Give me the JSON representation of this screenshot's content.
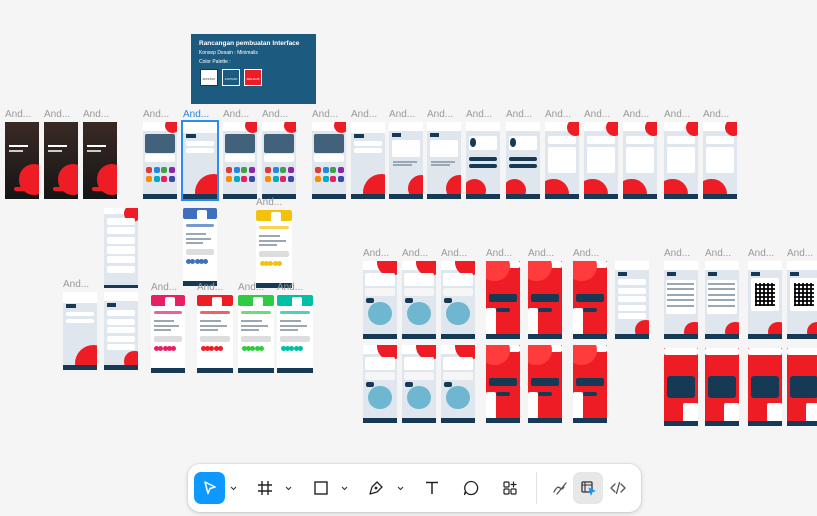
{
  "canvas": {
    "frame_label": "And...",
    "selected_frame_label": "And..."
  },
  "spec_card": {
    "title": "Rancangan pembuatan Interface",
    "concept": "Konsep Desain : Minimalis",
    "palette_label": "Color Palette :",
    "swatches": [
      {
        "label": "#FFFFFF",
        "color": "#ffffff"
      },
      {
        "label": "#1D5A80",
        "color": "#1d5a80"
      },
      {
        "label": "#EE1C25",
        "color": "#ee1c25"
      }
    ]
  },
  "colors": {
    "accent": "#0d99ff",
    "brand_navy": "#163a55",
    "brand_red": "#ee1c25",
    "canvas_bg": "#f5f5f5"
  },
  "toolbar": {
    "tools": [
      {
        "name": "move-tool",
        "icon": "cursor-icon",
        "active": true
      },
      {
        "name": "frame-tool",
        "icon": "hash-frame-icon"
      },
      {
        "name": "shape-tool",
        "icon": "rectangle-icon"
      },
      {
        "name": "pen-tool",
        "icon": "pen-icon"
      },
      {
        "name": "text-tool",
        "icon": "text-icon"
      },
      {
        "name": "comment-tool",
        "icon": "comment-icon"
      },
      {
        "name": "actions-tool",
        "icon": "actions-icon"
      },
      {
        "name": "draw-mode",
        "icon": "draw-icon"
      },
      {
        "name": "design-mode",
        "icon": "design-mode-icon",
        "active": true
      },
      {
        "name": "dev-mode",
        "icon": "code-icon"
      }
    ]
  }
}
